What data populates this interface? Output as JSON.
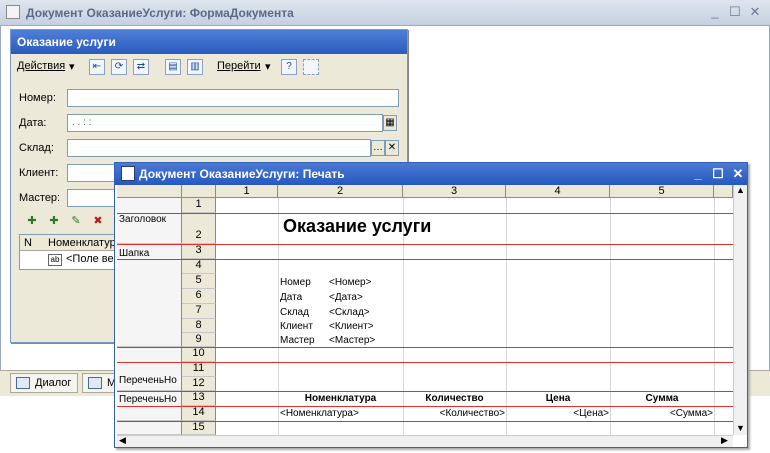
{
  "outer": {
    "title": "Документ ОказаниеУслуги: ФормаДокумента"
  },
  "form": {
    "title": "Оказание услуги",
    "toolbar": {
      "actions": "Действия",
      "goto": "Перейти"
    },
    "fields": [
      {
        "label": "Номер:",
        "value": ""
      },
      {
        "label": "Дата:",
        "value": " .  .      :  :"
      },
      {
        "label": "Склад:",
        "value": ""
      },
      {
        "label": "Клиент:",
        "value": ""
      },
      {
        "label": "Мастер:",
        "value": ""
      }
    ],
    "grid": {
      "col_n": "N",
      "col_nom": "Номенклатура",
      "row_text": "<Поле ве"
    }
  },
  "tabs": {
    "dialog": "Диалог",
    "module": "М"
  },
  "print": {
    "title": "Документ ОказаниеУслуги: Печать",
    "columns": [
      "1",
      "2",
      "3",
      "4",
      "5"
    ],
    "rows": [
      "1",
      "2",
      "3",
      "4",
      "5",
      "6",
      "7",
      "8",
      "9",
      "10",
      "11",
      "12",
      "13",
      "14",
      "15"
    ],
    "sections": [
      "Заголовок",
      "Шапка",
      "ПереченьНо",
      "ПереченьНо"
    ],
    "heading": "Оказание услуги",
    "header_fields": [
      {
        "label": "Номер",
        "param": "<Номер>"
      },
      {
        "label": "Дата",
        "param": "<Дата>"
      },
      {
        "label": "Склад",
        "param": "<Склад>"
      },
      {
        "label": "Клиент",
        "param": "<Клиент>"
      },
      {
        "label": "Мастер",
        "param": "<Мастер>"
      }
    ],
    "table_headers": [
      "Номенклатура",
      "Количество",
      "Цена",
      "Сумма"
    ],
    "table_params": [
      "<Номенклатура>",
      "<Количество>",
      "<Цена>",
      "<Сумма>"
    ]
  }
}
